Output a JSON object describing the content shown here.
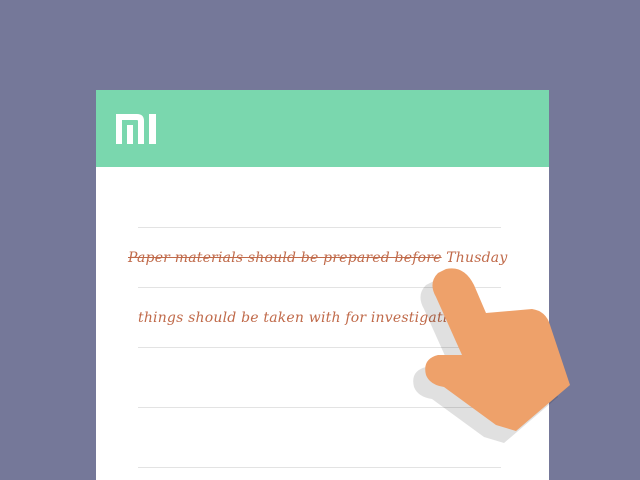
{
  "brand": {
    "logo_icon": "mi-logo-icon",
    "header_color": "#7ad7ae",
    "background_color": "#757899"
  },
  "notes": [
    {
      "struck_text": "Paper materials should be prepared before",
      "plain_text": " Thusday",
      "completed": true
    },
    {
      "text": "things should be taken with for investigati",
      "completed": false
    }
  ],
  "gesture": {
    "icon": "pointing-hand-icon",
    "color": "#eea16a"
  }
}
